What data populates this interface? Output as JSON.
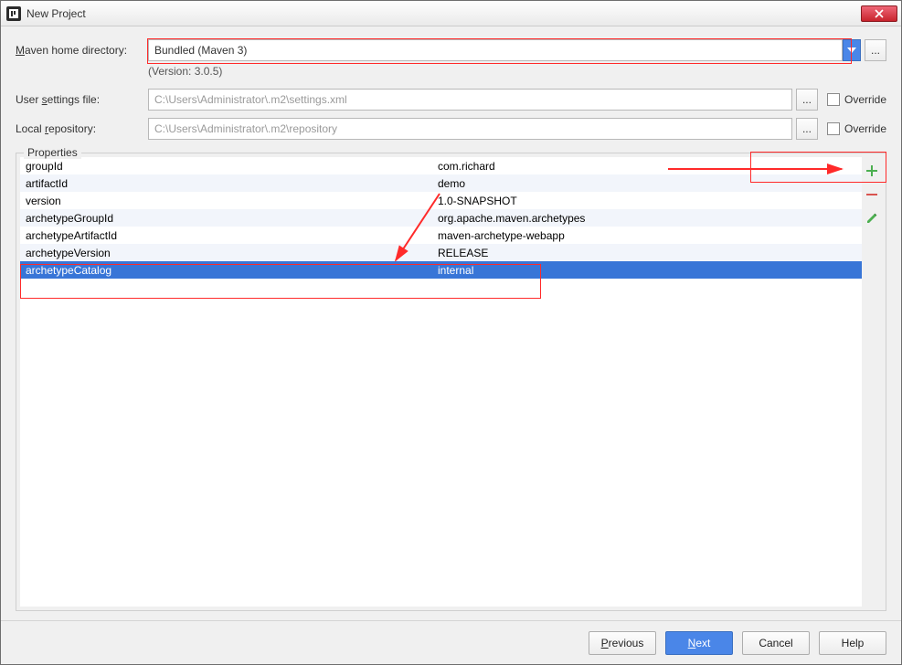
{
  "window": {
    "title": "New Project"
  },
  "maven": {
    "home_label": "Maven home directory:",
    "home_mn": "M",
    "home_value": "Bundled (Maven 3)",
    "version_note": "(Version: 3.0.5)"
  },
  "settings": {
    "label": "User settings file:",
    "label_mn": "s",
    "value": "C:\\Users\\Administrator\\.m2\\settings.xml",
    "override_label": "Override"
  },
  "repo": {
    "label": "Local repository:",
    "label_mn": "r",
    "value": "C:\\Users\\Administrator\\.m2\\repository",
    "override_label": "Override"
  },
  "properties": {
    "title": "Properties",
    "rows": [
      {
        "key": "groupId",
        "value": "com.richard"
      },
      {
        "key": "artifactId",
        "value": "demo"
      },
      {
        "key": "version",
        "value": "1.0-SNAPSHOT"
      },
      {
        "key": "archetypeGroupId",
        "value": "org.apache.maven.archetypes"
      },
      {
        "key": "archetypeArtifactId",
        "value": "maven-archetype-webapp"
      },
      {
        "key": "archetypeVersion",
        "value": "RELEASE"
      },
      {
        "key": "archetypeCatalog",
        "value": "internal"
      }
    ],
    "selected_index": 6
  },
  "footer": {
    "previous": "Previous",
    "previous_mn": "P",
    "next": "Next",
    "next_mn": "N",
    "cancel": "Cancel",
    "help": "Help"
  },
  "icons": {
    "ellipsis": "...",
    "add": "+",
    "remove": "−",
    "edit": "✎"
  }
}
